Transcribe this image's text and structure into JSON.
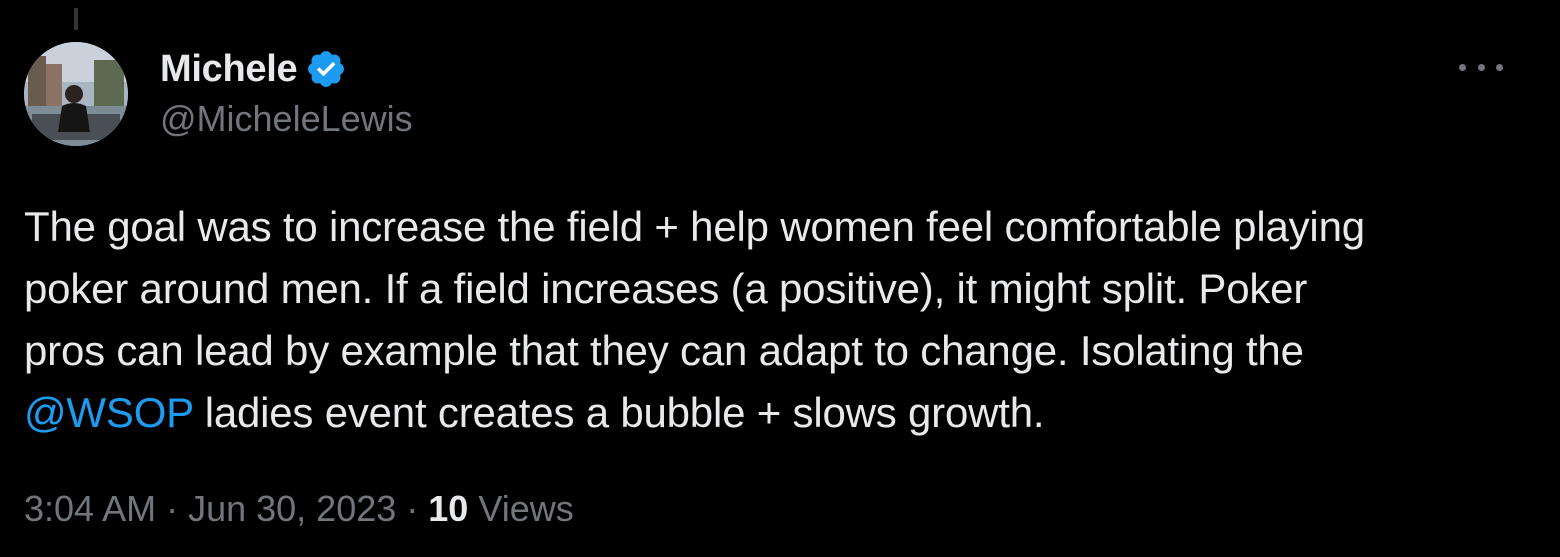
{
  "author": {
    "display_name": "Michele",
    "handle": "@MicheleLewis",
    "verified_icon": "verified-badge-icon"
  },
  "tweet": {
    "lines": [
      {
        "text": "The goal was to increase the field + help women feel comfortable playing"
      },
      {
        "text": "poker around men. If a field increases (a positive), it might split. Poker"
      },
      {
        "text": "pros can lead by example that they can adapt to change. Isolating the"
      },
      {
        "mention": "@WSOP",
        "text": " ladies event creates a bubble + slows growth."
      }
    ]
  },
  "meta": {
    "time": "3:04 AM",
    "separator": "·",
    "date": "Jun 30, 2023",
    "views_count": "10",
    "views_label": "Views"
  },
  "colors": {
    "background": "#000000",
    "text": "#e7e9ea",
    "secondary": "#71767b",
    "accent": "#1d9bf0"
  },
  "icons": {
    "more": "more-horizontal-icon",
    "verified": "verified-badge-icon"
  }
}
